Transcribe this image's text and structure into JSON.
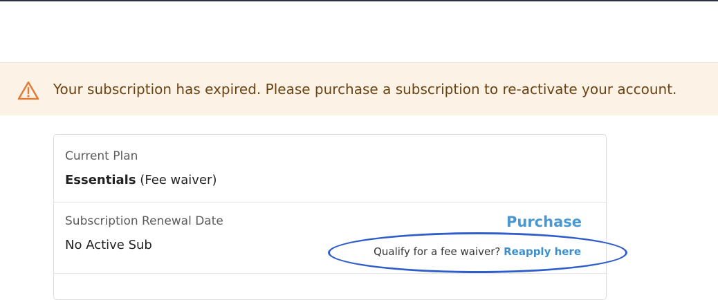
{
  "alert": {
    "icon": "warning-triangle-icon",
    "message": "Your subscription has expired. Please purchase a subscription to re-activate your account.",
    "background": "#fcf3e6",
    "text_color": "#6b4212",
    "icon_color": "#e07b39"
  },
  "plan": {
    "label": "Current Plan",
    "name": "Essentials",
    "type": "(Fee waiver)"
  },
  "renewal": {
    "label": "Subscription Renewal Date",
    "value": "No Active Sub",
    "purchase_label": "Purchase",
    "waiver_prompt": "Qualify for a fee waiver?",
    "reapply_link": "Reapply here"
  },
  "colors": {
    "link": "#4a98d2",
    "annotation_oval": "#2f5ec9"
  }
}
